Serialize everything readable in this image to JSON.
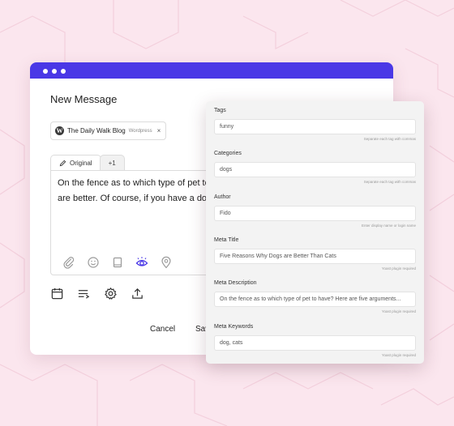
{
  "colors": {
    "background": "#fbe6ee",
    "titlebar": "#4a38e6",
    "accent": "#4a38e6"
  },
  "composer": {
    "title": "New Message",
    "account": {
      "name": "The Daily Walk Blog",
      "platform": "Wordpress",
      "remove": "×",
      "icon": "wordpress-icon"
    },
    "tabs": [
      {
        "label": "Original",
        "icon": "pencil-icon"
      },
      {
        "label": "+1"
      }
    ],
    "body_lines": [
      "On the fence as to which type of pet to ha",
      "are better. Of course, if you have a dog, yo"
    ],
    "editor_tools": [
      "paperclip-icon",
      "emoji-icon",
      "book-icon",
      "eye-icon",
      "location-pin-icon"
    ],
    "toolbar": [
      "calendar-icon",
      "queue-icon",
      "gear-icon",
      "upload-icon"
    ],
    "cancel_label": "Cancel",
    "save_label": "Sav"
  },
  "fields": [
    {
      "label": "Tags",
      "value": "funny",
      "hint": "Separate each tag with commas"
    },
    {
      "label": "Categories",
      "value": "dogs",
      "hint": "Separate each tag with commas"
    },
    {
      "label": "Author",
      "value": "Fido",
      "hint": "Enter display name or login name"
    },
    {
      "label": "Meta Title",
      "value": "Five Reasons Why Dogs are Better Than Cats",
      "hint": "Yoast plugin required"
    },
    {
      "label": "Meta Description",
      "value": "On the fence as to which type of pet to have? Here are five arguments...",
      "hint": "Yoast plugin required"
    },
    {
      "label": "Meta Keywords",
      "value": "dog, cats",
      "hint": "Yoast plugin required"
    }
  ]
}
